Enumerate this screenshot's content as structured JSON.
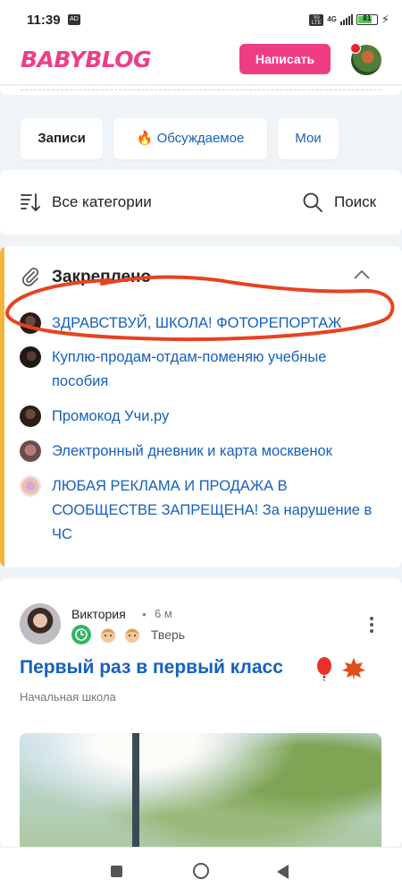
{
  "status_bar": {
    "time": "11:39",
    "battery": "81",
    "network": "4G"
  },
  "header": {
    "logo": "BABYBLOG",
    "write_button": "Написать"
  },
  "tabs": [
    {
      "label": "Записи"
    },
    {
      "label": "Обсуждаемое",
      "icon": "fire-icon"
    },
    {
      "label": "Мои"
    }
  ],
  "filters": {
    "categories_label": "Все категории",
    "search_label": "Поиск"
  },
  "pinned": {
    "title": "Закреплено",
    "items": [
      {
        "text": "ЗДРАВСТВУЙ, ШКОЛА! ФОТОРЕПОРТАЖ"
      },
      {
        "text": "Куплю-продам-отдам-поменяю учебные пособия"
      },
      {
        "text": "Промокод Учи.ру"
      },
      {
        "text": "Электронный дневник и карта москвенок"
      },
      {
        "text": "ЛЮБАЯ РЕКЛАМА И ПРОДАЖА В СООБЩЕСТВЕ ЗАПРЕЩЕНА! За нарушение в ЧС"
      }
    ]
  },
  "post": {
    "author": "Виктория",
    "separator": "•",
    "time": "6 м",
    "city": "Тверь",
    "title": "Первый раз в первый класс",
    "category": "Начальная школа"
  },
  "colors": {
    "accent_pink": "#ef3d84",
    "link_blue": "#1560bd",
    "pinned_bar": "#f4b53f",
    "annotation_red": "#e8421f"
  }
}
